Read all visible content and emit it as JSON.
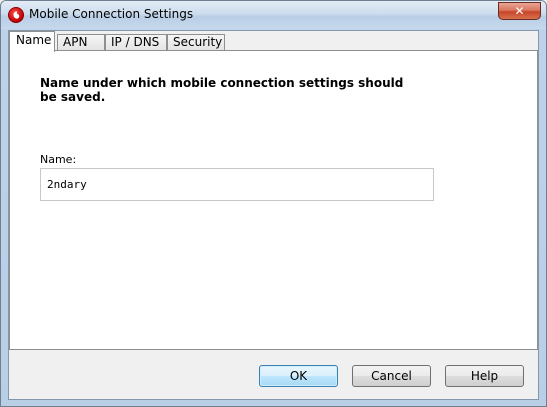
{
  "window": {
    "title": "Mobile Connection Settings",
    "close_label": "✕"
  },
  "tabs": [
    {
      "label": "Name",
      "active": true
    },
    {
      "label": "APN",
      "active": false
    },
    {
      "label": "IP / DNS",
      "active": false
    },
    {
      "label": "Security",
      "active": false
    }
  ],
  "panel": {
    "instruction": "Name under which mobile connection settings should be saved.",
    "name_label": "Name:",
    "name_value": "2ndary"
  },
  "buttons": {
    "ok": "OK",
    "cancel": "Cancel",
    "help": "Help"
  },
  "colors": {
    "brand_icon": "#c00000",
    "default_button_border": "#3c7fb1",
    "titlebar": "#b9cfe6"
  },
  "icons": {
    "app": "vodafone-logo-icon",
    "close": "close-icon"
  }
}
